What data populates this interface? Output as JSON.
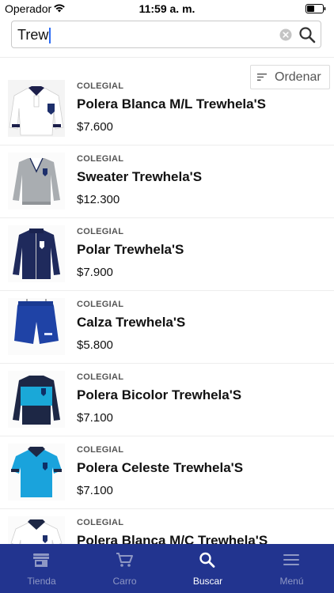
{
  "status_bar": {
    "carrier": "Operador",
    "time": "11:59 a. m.",
    "icons": [
      "wifi-icon",
      "battery-icon"
    ]
  },
  "search": {
    "value": "Trew",
    "icons": [
      "clear-icon",
      "search-icon"
    ]
  },
  "sort": {
    "label": "Ordenar",
    "icon": "sort-icon"
  },
  "products": [
    {
      "category": "COLEGIAL",
      "name": "Polera Blanca M/L Trewhela'S",
      "price": "$7.600",
      "image": "white-longsleeve-polo"
    },
    {
      "category": "COLEGIAL",
      "name": "Sweater Trewhela'S",
      "price": "$12.300",
      "image": "gray-sweater"
    },
    {
      "category": "COLEGIAL",
      "name": "Polar Trewhela'S",
      "price": "$7.900",
      "image": "navy-fleece-jacket"
    },
    {
      "category": "COLEGIAL",
      "name": "Calza Trewhela'S",
      "price": "$5.800",
      "image": "blue-shorts"
    },
    {
      "category": "COLEGIAL",
      "name": "Polera Bicolor Trewhela'S",
      "price": "$7.100",
      "image": "bicolor-polo"
    },
    {
      "category": "COLEGIAL",
      "name": "Polera Celeste Trewhela'S",
      "price": "$7.100",
      "image": "cyan-polo"
    },
    {
      "category": "COLEGIAL",
      "name": "Polera Blanca M/C Trewhela'S",
      "price": "",
      "image": "white-shortsleeve-polo"
    }
  ],
  "tab_bar": {
    "items": [
      {
        "label": "Tienda",
        "icon": "store-icon"
      },
      {
        "label": "Carro",
        "icon": "cart-icon"
      },
      {
        "label": "Buscar",
        "icon": "search-icon",
        "active": true
      },
      {
        "label": "Menú",
        "icon": "menu-icon"
      }
    ]
  },
  "colors": {
    "tab_bar_bg": "#22348f",
    "tab_active": "#ffffff",
    "tab_inactive": "#8e97c4",
    "caret": "#2c6cf5"
  }
}
